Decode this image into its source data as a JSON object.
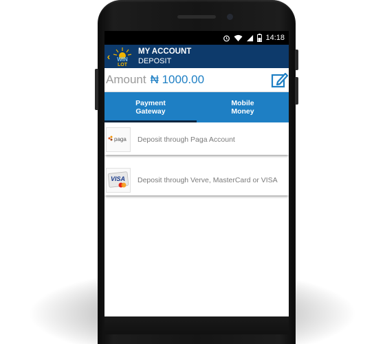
{
  "status_bar": {
    "time": "14:18"
  },
  "app_bar": {
    "title": "MY ACCOUNT",
    "subtitle": "DEPOSIT",
    "logo_text": "WIN LOT"
  },
  "amount": {
    "label": "Amount",
    "value": "₦ 1000.00"
  },
  "tabs": [
    {
      "line1": "Payment",
      "line2": "Gateway",
      "active": true
    },
    {
      "line1": "Mobile",
      "line2": "Money",
      "active": false
    }
  ],
  "options": [
    {
      "icon": "paga-logo",
      "icon_text": "paga",
      "label": "Deposit through Paga Account"
    },
    {
      "icon": "visa-card-icon",
      "icon_text": "VISA",
      "label": "Deposit through Verve, MasterCard or VISA"
    }
  ],
  "colors": {
    "app_bar": "#0d3a6b",
    "accent": "#1e7fc4",
    "back_arrow": "#f0b400"
  }
}
